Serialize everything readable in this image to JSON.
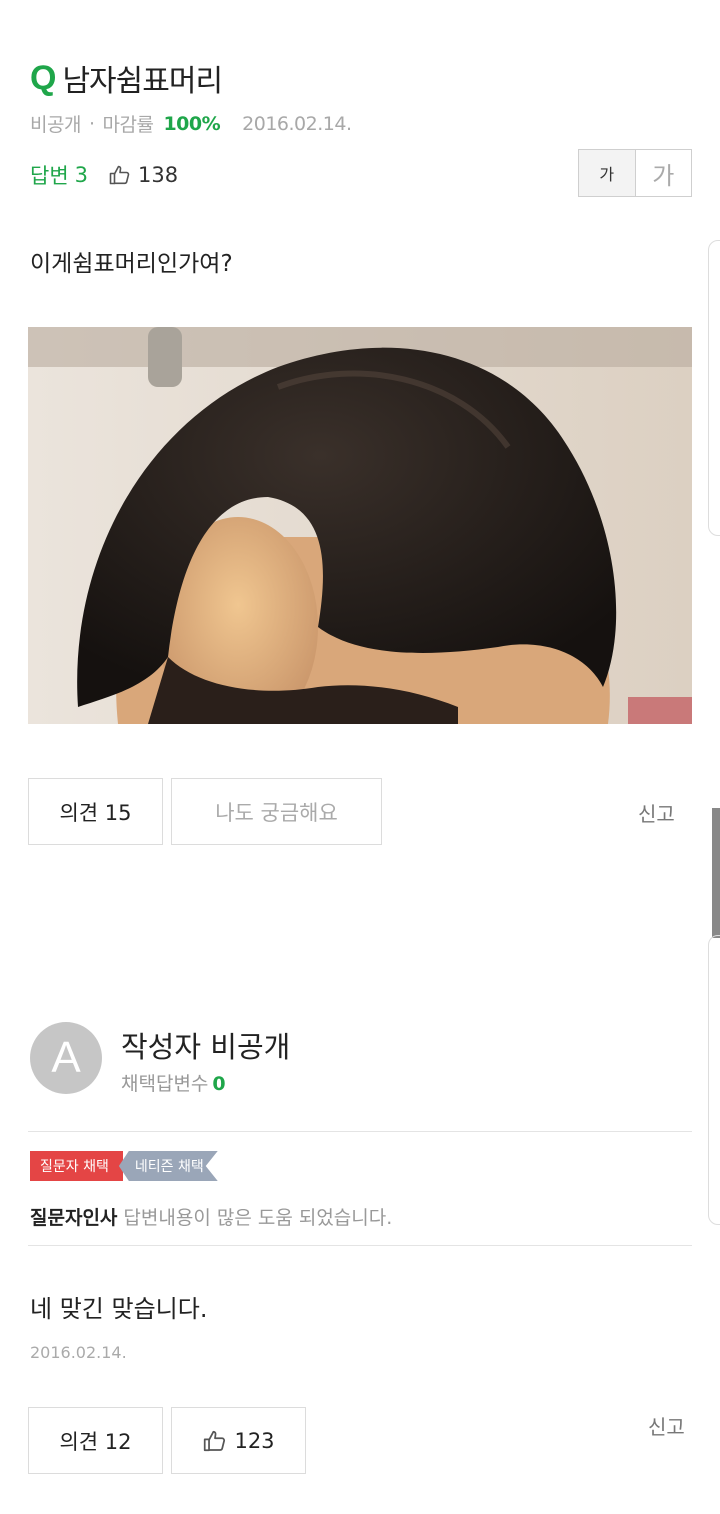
{
  "question": {
    "mark": "Q",
    "title": "남자쉼표머리",
    "visibility": "비공개",
    "dot": "·",
    "closing_rate_label": "마감률",
    "closing_rate_value": "100%",
    "date": "2016.02.14.",
    "answers_label": "답변",
    "answers_count": "3",
    "likes_count": "138",
    "font_small_label": "가",
    "font_large_label": "가",
    "body": "이게쉼표머리인가여?",
    "opinion_button": "의견 15",
    "curious_button": "나도 궁금해요",
    "report": "신고"
  },
  "answer": {
    "avatar_letter": "A",
    "author": "작성자 비공개",
    "adopted_label": "채택답변수",
    "adopted_count": "0",
    "badge_asker": "질문자 채택",
    "badge_netizen": "네티즌 채택",
    "greeting_label": "질문자인사",
    "greeting_msg": "답변내용이 많은 도움 되었습니다.",
    "text": "네 맞긴 맞습니다.",
    "date": "2016.02.14.",
    "opinion_button": "의견 12",
    "likes_count": "123",
    "report": "신고"
  },
  "icons": {
    "like": "thumbs-up-icon",
    "photo": "hair-photo"
  },
  "colors": {
    "accent": "#1fa64a",
    "badge_red": "#e44545",
    "badge_gray": "#9aa6b8"
  }
}
